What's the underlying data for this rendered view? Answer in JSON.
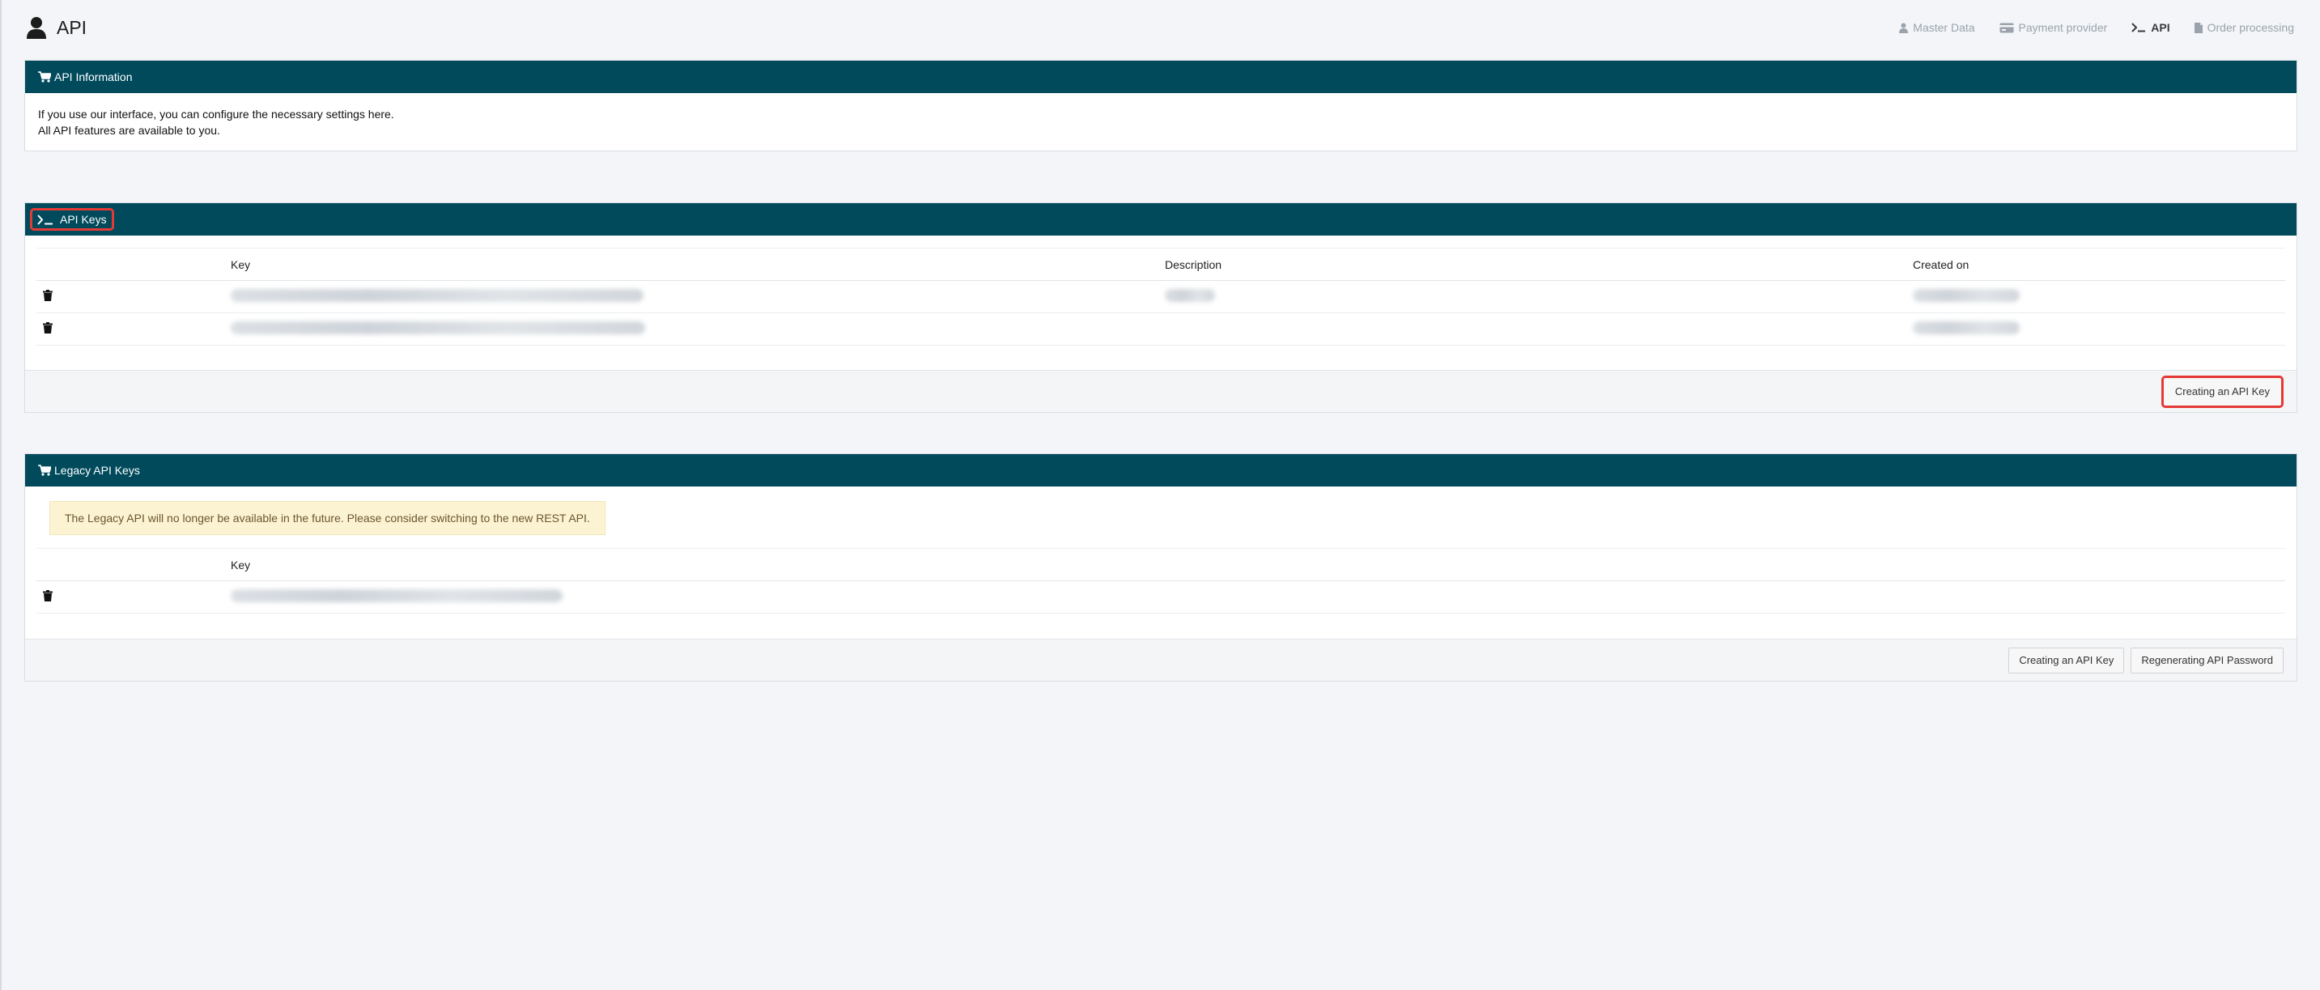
{
  "header": {
    "title": "API"
  },
  "nav": {
    "items": [
      {
        "label": "Master Data",
        "icon": "user-icon"
      },
      {
        "label": "Payment provider",
        "icon": "credit-card-icon"
      },
      {
        "label": "API",
        "icon": "terminal-icon",
        "active": true
      },
      {
        "label": "Order processing",
        "icon": "document-icon"
      }
    ]
  },
  "info_panel": {
    "title": "API Information",
    "line1": "If you use our interface, you can configure the necessary settings here.",
    "line2": "All API features are available to you."
  },
  "keys_panel": {
    "title": "API Keys",
    "columns": {
      "key": "Key",
      "description": "Description",
      "created": "Created on"
    },
    "create_label": "Creating an API Key"
  },
  "legacy_panel": {
    "title": "Legacy API Keys",
    "alert": "The Legacy API will no longer be available in the future. Please consider switching to the new REST API.",
    "columns": {
      "key": "Key"
    },
    "create_label": "Creating an API Key",
    "regenerate_label": "Regenerating API Password"
  },
  "colors": {
    "panel_heading": "#004a5c",
    "highlight": "#e53935",
    "alert_bg": "#fcf3d2"
  }
}
